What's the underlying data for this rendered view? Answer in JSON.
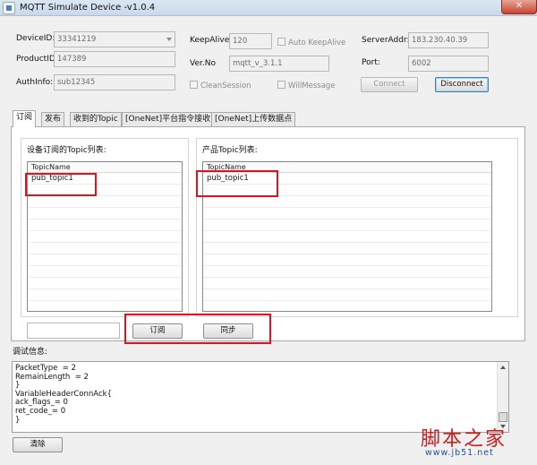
{
  "window": {
    "title": "MQTT Simulate Device  -v1.0.4",
    "close_glyph": "✕"
  },
  "device": {
    "device_id_label": "DeviceID:",
    "device_id_value": "33341219",
    "product_id_label": "ProductID:",
    "product_id_value": "147389",
    "auth_info_label": "AuthInfo:",
    "auth_info_value": "sub12345"
  },
  "connection": {
    "keepalive_label": "KeepAlive:",
    "keepalive_value": "120",
    "auto_keepalive_label": "Auto KeepAlive",
    "ver_label": "Ver.No",
    "ver_value": "mqtt_v_3.1.1",
    "clean_session_label": "CleanSession",
    "will_message_label": "WillMessage",
    "server_label": "ServerAddr:",
    "server_value": "183.230.40.39",
    "port_label": "Port:",
    "port_value": "6002",
    "connect_label": "Connect",
    "disconnect_label": "Disconnect"
  },
  "tabs": [
    {
      "label": "订阅"
    },
    {
      "label": "发布"
    },
    {
      "label": "收到的Topic"
    },
    {
      "label": "[OneNet]平台指令接收"
    },
    {
      "label": "[OneNet]上传数据点"
    }
  ],
  "subscribe": {
    "device_group_title": "设备订阅的Topic列表:",
    "product_group_title": "产品Topic列表:",
    "device_list": {
      "column": "TopicName",
      "rows": [
        "pub_topic1"
      ]
    },
    "product_list": {
      "column": "TopicName",
      "rows": [
        "pub_topic1"
      ]
    },
    "topic_input_value": "",
    "subscribe_button": "订阅",
    "sync_button": "同步"
  },
  "debug": {
    "label": "调试信息:",
    "lines": [
      "PacketType  = 2",
      "RemainLength  = 2",
      "}",
      "VariableHeaderConnAck{",
      "ack_flags_= 0",
      "ret_code_= 0",
      "}"
    ],
    "clear_button": "清除"
  },
  "watermark": {
    "text": "脚本之家",
    "url": "www.jb51.net"
  },
  "colors": {
    "highlight": "#e0121c"
  }
}
